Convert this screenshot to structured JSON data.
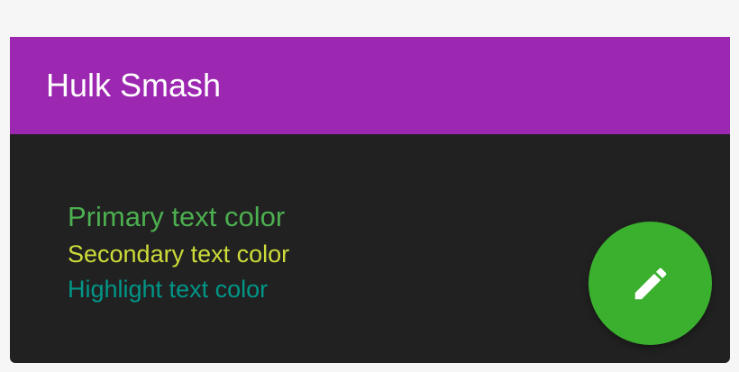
{
  "app_bar": {
    "title": "Hulk Smash",
    "background_color": "#9c27b0",
    "title_color": "#ffffff"
  },
  "content": {
    "background_color": "#212121",
    "lines": {
      "primary": {
        "text": "Primary text color",
        "color": "#4caf50"
      },
      "secondary": {
        "text": "Secondary text color",
        "color": "#cddc39"
      },
      "highlight": {
        "text": "Highlight text color",
        "color": "#009688"
      }
    }
  },
  "fab": {
    "icon": "pencil-icon",
    "background_color": "#3ab02e",
    "icon_color": "#ffffff"
  },
  "page_background_color": "#f6f6f6"
}
